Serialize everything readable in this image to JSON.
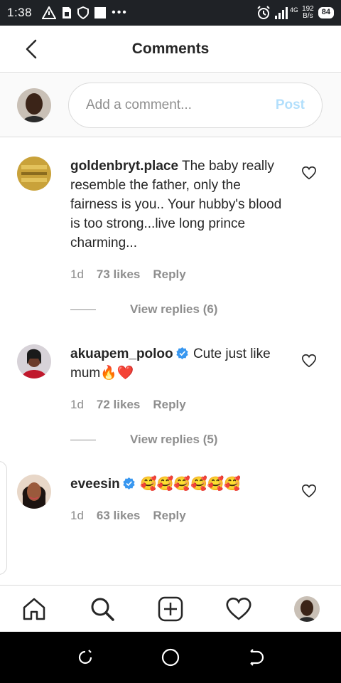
{
  "status_bar": {
    "time": "1:38",
    "network": "4G",
    "speed_value": "192",
    "speed_unit": "B/s",
    "battery": "84"
  },
  "header": {
    "title": "Comments"
  },
  "composer": {
    "placeholder": "Add a comment...",
    "post_label": "Post"
  },
  "comments": [
    {
      "username": "goldenbryt.place",
      "verified": false,
      "text": "The baby really resemble the father, only the fairness is you.. Your hubby's blood is too strong...live long prince charming...",
      "age": "1d",
      "likes": "73 likes",
      "reply": "Reply",
      "view_replies": "View replies (6)"
    },
    {
      "username": "akuapem_poloo",
      "verified": true,
      "text": "Cute just like mum🔥❤️",
      "age": "1d",
      "likes": "72 likes",
      "reply": "Reply",
      "view_replies": "View replies (5)"
    },
    {
      "username": "eveesin",
      "verified": true,
      "text": "🥰🥰🥰🥰🥰🥰",
      "age": "1d",
      "likes": "63 likes",
      "reply": "Reply"
    }
  ],
  "colors": {
    "verified": "#3897f0",
    "post_disabled": "#b2dffc",
    "secondary_text": "#8e8e8e",
    "divider": "#dbdbdb"
  },
  "tabs": [
    "home-icon",
    "search-icon",
    "add-post-icon",
    "activity-heart-icon",
    "profile-avatar"
  ]
}
